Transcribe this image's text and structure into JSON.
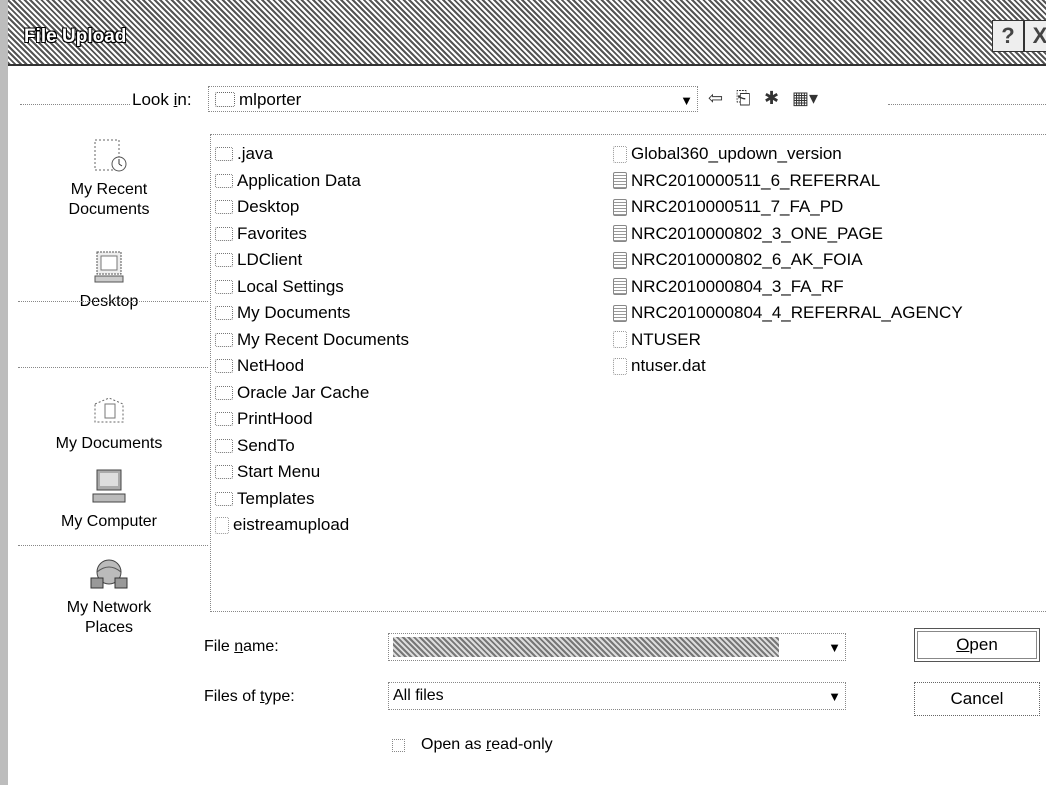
{
  "window": {
    "title": "File Upload",
    "help_glyph": "?",
    "close_glyph": "X"
  },
  "look_in": {
    "label": "Look in:",
    "value": "mlporter"
  },
  "places": [
    {
      "label_line1": "My Recent",
      "label_line2": "Documents",
      "icon": "recent-documents-icon"
    },
    {
      "label_line1": "Desktop",
      "label_line2": "",
      "icon": "desktop-icon"
    },
    {
      "label_line1": "My Documents",
      "label_line2": "",
      "icon": "my-documents-icon"
    },
    {
      "label_line1": "My Computer",
      "label_line2": "",
      "icon": "my-computer-icon"
    },
    {
      "label_line1": "My Network",
      "label_line2": "Places",
      "icon": "network-places-icon"
    }
  ],
  "files": {
    "column1": [
      {
        "name": ".java",
        "type": "folder"
      },
      {
        "name": "Application Data",
        "type": "folder"
      },
      {
        "name": "Desktop",
        "type": "folder"
      },
      {
        "name": "Favorites",
        "type": "folder"
      },
      {
        "name": "LDClient",
        "type": "folder"
      },
      {
        "name": "Local Settings",
        "type": "folder"
      },
      {
        "name": "My Documents",
        "type": "folder"
      },
      {
        "name": "My Recent Documents",
        "type": "folder"
      },
      {
        "name": "NetHood",
        "type": "folder"
      },
      {
        "name": "Oracle Jar Cache",
        "type": "folder"
      },
      {
        "name": "PrintHood",
        "type": "folder"
      },
      {
        "name": "SendTo",
        "type": "folder"
      },
      {
        "name": "Start Menu",
        "type": "folder"
      },
      {
        "name": "Templates",
        "type": "folder"
      },
      {
        "name": "eistreamupload",
        "type": "file"
      }
    ],
    "column2": [
      {
        "name": "Global360_updown_version",
        "type": "file"
      },
      {
        "name": "NRC2010000511_6_REFERRAL",
        "type": "doc"
      },
      {
        "name": "NRC2010000511_7_FA_PD",
        "type": "doc"
      },
      {
        "name": "NRC2010000802_3_ONE_PAGE",
        "type": "doc"
      },
      {
        "name": "NRC2010000802_6_AK_FOIA",
        "type": "doc"
      },
      {
        "name": "NRC2010000804_3_FA_RF",
        "type": "doc"
      },
      {
        "name": "NRC2010000804_4_REFERRAL_AGENCY",
        "type": "doc"
      },
      {
        "name": "NTUSER",
        "type": "file"
      },
      {
        "name": "ntuser.dat",
        "type": "file"
      }
    ]
  },
  "bottom": {
    "file_name_label": "File name:",
    "files_of_type_label": "Files of type:",
    "files_of_type_value": "All files",
    "open_button": "Open",
    "cancel_button": "Cancel",
    "readonly_label": "Open as read-only"
  }
}
